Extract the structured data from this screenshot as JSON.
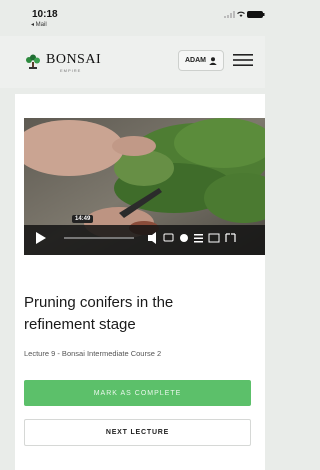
{
  "status_bar": {
    "time": "10:18",
    "back_label": "◂ Mail"
  },
  "header": {
    "brand": "BONSAI",
    "brand_sub": "EMPIRE",
    "account_label": "ADAM"
  },
  "video": {
    "timestamp": "14:49"
  },
  "lesson": {
    "title": "Pruning conifers in the refinement stage",
    "subtitle": "Lecture 9 - Bonsai Intermediate Course 2"
  },
  "actions": {
    "complete_label": "MARK AS COMPLETE",
    "next_label": "NEXT LECTURE"
  },
  "colors": {
    "accent_green": "#5cc06a",
    "background": "#e9ece9"
  }
}
